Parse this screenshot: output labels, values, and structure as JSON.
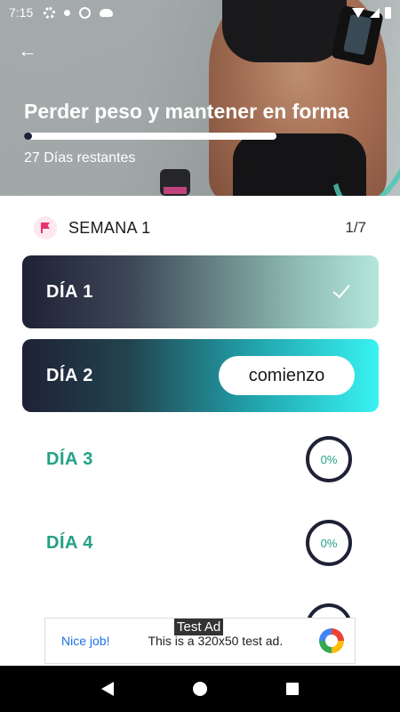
{
  "status_bar": {
    "time": "7:15",
    "icons": [
      "gear-icon",
      "dot-icon",
      "at-sign-icon",
      "cloud-icon",
      "wifi-icon",
      "signal-icon",
      "battery-icon"
    ]
  },
  "header": {
    "title": "Perder peso y mantener en forma",
    "progress": 0.03,
    "days_remaining": "27 Días restantes"
  },
  "week": {
    "label": "SEMANA 1",
    "count": "1/7"
  },
  "days": [
    {
      "label": "DÍA 1",
      "state": "completed"
    },
    {
      "label": "DÍA 2",
      "state": "current",
      "button": "comienzo"
    },
    {
      "label": "DÍA 3",
      "state": "pending",
      "progress": "0%"
    },
    {
      "label": "DÍA 4",
      "state": "pending",
      "progress": "0%"
    }
  ],
  "ad": {
    "tag": "Test Ad",
    "headline": "Nice job!",
    "body": "This is a 320x50 test ad."
  },
  "colors": {
    "accent": "#22a186",
    "dark": "#1f2136",
    "cyan": "#39f2f2",
    "flag": "#e8326b"
  }
}
